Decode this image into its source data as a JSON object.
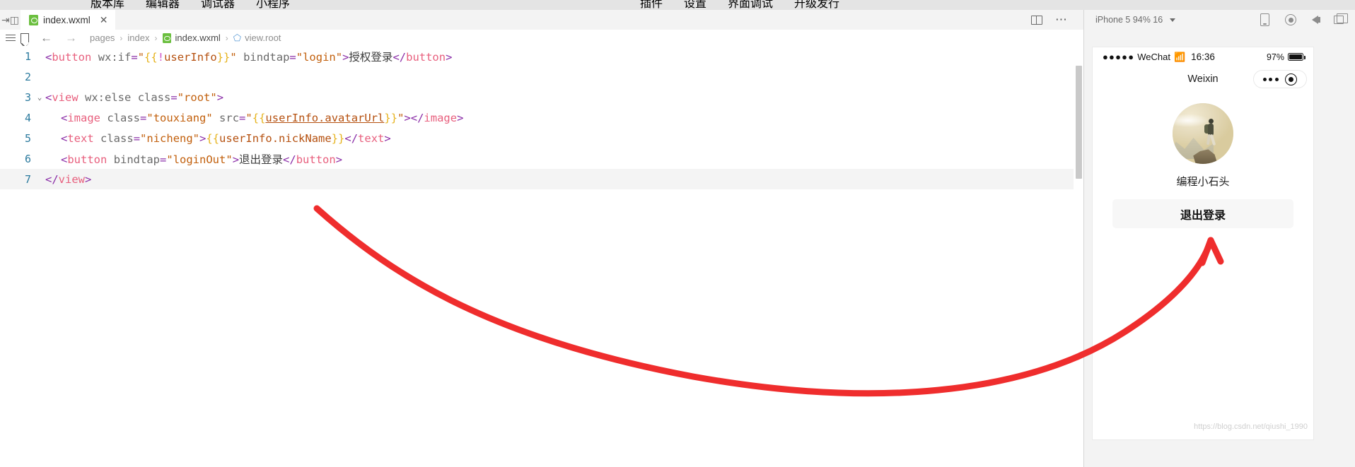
{
  "menu": {
    "left_items": [
      "版本库",
      "编辑器",
      "调试器",
      "小程序"
    ],
    "right_items": [
      "插件",
      "设置",
      "界面调试",
      "升级发行"
    ]
  },
  "tabbar": {
    "tab_label": "index.wxml",
    "tab_icon": "wxml-file-icon",
    "close_icon": "close-icon",
    "split_editor_icon": "split-editor-icon",
    "more_actions_icon": "more-actions-icon"
  },
  "breadcrumb": {
    "outline_icon": "outline-list-icon",
    "bookmark_icon": "bookmark-icon",
    "back_icon": "arrow-left-icon",
    "forward_icon": "arrow-right-icon",
    "separator": "›",
    "items": [
      "pages",
      "index",
      "index.wxml",
      "view.root"
    ]
  },
  "editor": {
    "language": "wxml",
    "lines": [
      {
        "number": "1",
        "foldable": false,
        "tokens": [
          {
            "t": "punc",
            "v": "<"
          },
          {
            "t": "tag",
            "v": "button"
          },
          {
            "t": "plain",
            "v": " "
          },
          {
            "t": "attr",
            "v": "wx:if"
          },
          {
            "t": "eq",
            "v": "="
          },
          {
            "t": "str",
            "v": "\""
          },
          {
            "t": "brace",
            "v": "{{"
          },
          {
            "t": "excl",
            "v": "!"
          },
          {
            "t": "expr",
            "v": "userInfo"
          },
          {
            "t": "brace",
            "v": "}}"
          },
          {
            "t": "str",
            "v": "\""
          },
          {
            "t": "plain",
            "v": " "
          },
          {
            "t": "attr",
            "v": "bindtap"
          },
          {
            "t": "eq",
            "v": "="
          },
          {
            "t": "str",
            "v": "\"login\""
          },
          {
            "t": "punc",
            "v": ">"
          },
          {
            "t": "text",
            "v": "授权登录"
          },
          {
            "t": "punc",
            "v": "</"
          },
          {
            "t": "tag",
            "v": "button"
          },
          {
            "t": "punc",
            "v": ">"
          }
        ]
      },
      {
        "number": "2",
        "foldable": false,
        "tokens": []
      },
      {
        "number": "3",
        "foldable": true,
        "tokens": [
          {
            "t": "punc",
            "v": "<"
          },
          {
            "t": "tag",
            "v": "view"
          },
          {
            "t": "plain",
            "v": " "
          },
          {
            "t": "attr",
            "v": "wx:else"
          },
          {
            "t": "plain",
            "v": " "
          },
          {
            "t": "attr",
            "v": "class"
          },
          {
            "t": "eq",
            "v": "="
          },
          {
            "t": "str",
            "v": "\"root\""
          },
          {
            "t": "punc",
            "v": ">"
          }
        ]
      },
      {
        "number": "4",
        "foldable": false,
        "indent": 1,
        "tokens": [
          {
            "t": "punc",
            "v": "<"
          },
          {
            "t": "tag",
            "v": "image"
          },
          {
            "t": "plain",
            "v": " "
          },
          {
            "t": "attr",
            "v": "class"
          },
          {
            "t": "eq",
            "v": "="
          },
          {
            "t": "str",
            "v": "\"touxiang\""
          },
          {
            "t": "plain",
            "v": " "
          },
          {
            "t": "attr",
            "v": "src"
          },
          {
            "t": "eq",
            "v": "="
          },
          {
            "t": "str",
            "v": "\""
          },
          {
            "t": "brace",
            "v": "{{"
          },
          {
            "t": "link",
            "v": "userInfo.avatarUrl"
          },
          {
            "t": "brace",
            "v": "}}"
          },
          {
            "t": "str",
            "v": "\""
          },
          {
            "t": "punc",
            "v": ">"
          },
          {
            "t": "punc",
            "v": "</"
          },
          {
            "t": "tag",
            "v": "image"
          },
          {
            "t": "punc",
            "v": ">"
          }
        ]
      },
      {
        "number": "5",
        "foldable": false,
        "indent": 1,
        "tokens": [
          {
            "t": "punc",
            "v": "<"
          },
          {
            "t": "tag",
            "v": "text"
          },
          {
            "t": "plain",
            "v": " "
          },
          {
            "t": "attr",
            "v": "class"
          },
          {
            "t": "eq",
            "v": "="
          },
          {
            "t": "str",
            "v": "\"nicheng\""
          },
          {
            "t": "punc",
            "v": ">"
          },
          {
            "t": "brace",
            "v": "{{"
          },
          {
            "t": "expr",
            "v": "userInfo.nickName"
          },
          {
            "t": "brace",
            "v": "}}"
          },
          {
            "t": "punc",
            "v": "</"
          },
          {
            "t": "tag",
            "v": "text"
          },
          {
            "t": "punc",
            "v": ">"
          }
        ]
      },
      {
        "number": "6",
        "foldable": false,
        "indent": 1,
        "tokens": [
          {
            "t": "punc",
            "v": "<"
          },
          {
            "t": "tag",
            "v": "button"
          },
          {
            "t": "plain",
            "v": " "
          },
          {
            "t": "attr",
            "v": "bindtap"
          },
          {
            "t": "eq",
            "v": "="
          },
          {
            "t": "str",
            "v": "\"loginOut\""
          },
          {
            "t": "punc",
            "v": ">"
          },
          {
            "t": "text",
            "v": "退出登录"
          },
          {
            "t": "punc",
            "v": "</"
          },
          {
            "t": "tag",
            "v": "button"
          },
          {
            "t": "punc",
            "v": ">"
          }
        ]
      },
      {
        "number": "7",
        "foldable": false,
        "highlight": true,
        "tokens": [
          {
            "t": "punc",
            "v": "</"
          },
          {
            "t": "tag",
            "v": "view"
          },
          {
            "t": "punc",
            "v": ">"
          }
        ]
      }
    ]
  },
  "simulator": {
    "device_label": "iPhone 5 94% 16",
    "dropdown_icon": "chevron-down-icon",
    "tools": [
      "phone-icon",
      "record-icon",
      "sound-icon",
      "window-icon"
    ],
    "status_bar": {
      "signal_dots": "●●●●●",
      "carrier": "WeChat",
      "wifi_icon": "wifi-icon",
      "time": "16:36",
      "battery_percent": "97%",
      "battery_icon": "battery-icon"
    },
    "nav_title": "Weixin",
    "capsule": {
      "menu_icon": "more-dots-icon",
      "close_icon": "target-circle-icon"
    },
    "page": {
      "avatar_alt": "user-avatar-hiker-on-mountain",
      "nickname": "编程小石头",
      "logout_label": "退出登录"
    },
    "watermark": "https://blog.csdn.net/qiushi_1990"
  },
  "annotation": {
    "type": "hand-drawn-arrow",
    "color": "#ef2d2d",
    "description": "red arrow from code line 6 to the logout button in the simulator"
  }
}
